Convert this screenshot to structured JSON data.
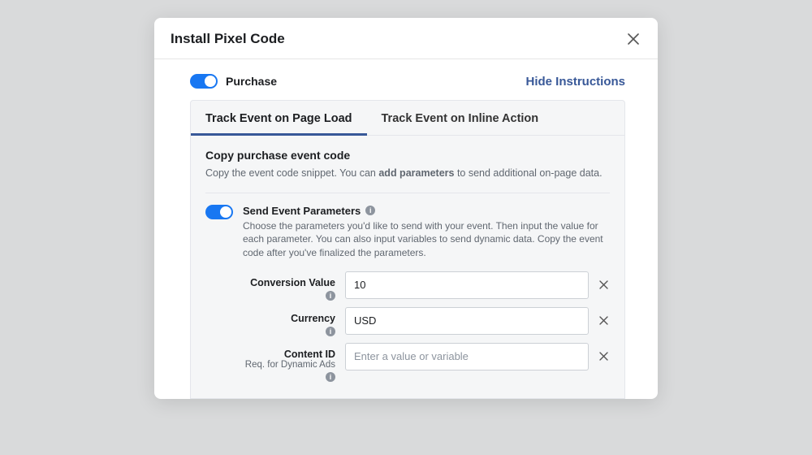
{
  "modal": {
    "title": "Install Pixel Code"
  },
  "toggle": {
    "purchase_label": "Purchase"
  },
  "hide_instructions": "Hide Instructions",
  "tabs": {
    "active": "Track Event on Page Load",
    "inactive": "Track Event on Inline Action"
  },
  "section": {
    "title": "Copy purchase event code",
    "desc_pre": "Copy the event code snippet. You can ",
    "desc_bold": "add parameters",
    "desc_post": " to send additional on-page data."
  },
  "params": {
    "title": "Send Event Parameters",
    "desc": "Choose the parameters you'd like to send with your event. Then input the value for each parameter. You can also input variables to send dynamic data. Copy the event code after you've finalized the parameters."
  },
  "fields": {
    "conversion": {
      "label": "Conversion Value",
      "value": "10"
    },
    "currency": {
      "label": "Currency",
      "value": "USD"
    },
    "content_id": {
      "label": "Content ID",
      "sub": "Req. for Dynamic Ads",
      "placeholder": "Enter a value or variable"
    }
  }
}
